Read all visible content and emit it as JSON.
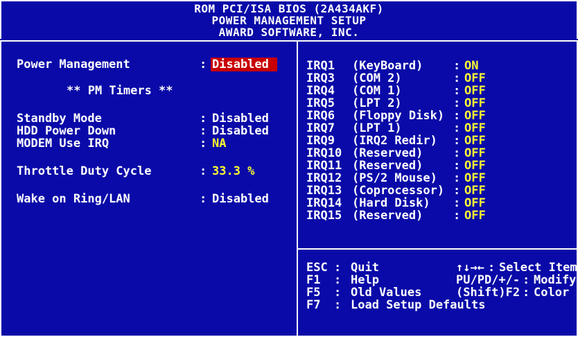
{
  "header": {
    "line1": "ROM PCI/ISA BIOS (2A434AKF)",
    "line2": "POWER MANAGEMENT SETUP",
    "line3": "AWARD SOFTWARE, INC."
  },
  "left": {
    "power_management": {
      "label": "Power Management",
      "value": "Disabled"
    },
    "pm_timers_heading": "** PM Timers **",
    "standby_mode": {
      "label": "Standby Mode",
      "value": "Disabled"
    },
    "hdd_power_down": {
      "label": "HDD Power Down",
      "value": "Disabled"
    },
    "modem_use_irq": {
      "label": "MODEM Use IRQ",
      "value": "NA"
    },
    "throttle_duty_cycle": {
      "label": "Throttle Duty Cycle",
      "value": "33.3 %"
    },
    "wake_on_ring_lan": {
      "label": "Wake on Ring/LAN",
      "value": "Disabled"
    }
  },
  "irqs": [
    {
      "irq": "IRQ1",
      "desc": "(KeyBoard)",
      "value": "ON"
    },
    {
      "irq": "IRQ3",
      "desc": "(COM 2)",
      "value": "OFF"
    },
    {
      "irq": "IRQ4",
      "desc": "(COM 1)",
      "value": "OFF"
    },
    {
      "irq": "IRQ5",
      "desc": "(LPT 2)",
      "value": "OFF"
    },
    {
      "irq": "IRQ6",
      "desc": "(Floppy Disk)",
      "value": "OFF"
    },
    {
      "irq": "IRQ7",
      "desc": "(LPT 1)",
      "value": "OFF"
    },
    {
      "irq": "IRQ9",
      "desc": "(IRQ2 Redir)",
      "value": "OFF"
    },
    {
      "irq": "IRQ10",
      "desc": "(Reserved)",
      "value": "OFF"
    },
    {
      "irq": "IRQ11",
      "desc": "(Reserved)",
      "value": "OFF"
    },
    {
      "irq": "IRQ12",
      "desc": "(PS/2 Mouse)",
      "value": "OFF"
    },
    {
      "irq": "IRQ13",
      "desc": "(Coprocessor)",
      "value": "OFF"
    },
    {
      "irq": "IRQ14",
      "desc": "(Hard Disk)",
      "value": "OFF"
    },
    {
      "irq": "IRQ15",
      "desc": "(Reserved)",
      "value": "OFF"
    }
  ],
  "help": {
    "esc_key": "ESC",
    "esc_text": "Quit",
    "f1_key": "F1",
    "f1_text": "Help",
    "f5_key": "F5",
    "f5_text": "Old Values",
    "f7_key": "F7",
    "f7_text": "Load Setup Defaults",
    "select_keys": "↑↓→←",
    "select_text": "Select Item",
    "modify_keys": "PU/PD/+/-",
    "modify_text": "Modify",
    "color_keys": "(Shift)F2",
    "color_text": "Color"
  },
  "colors": {
    "background": "#0a0aa8",
    "highlight": "#c80000",
    "option_value": "#ffff30",
    "text": "#ffffff"
  }
}
